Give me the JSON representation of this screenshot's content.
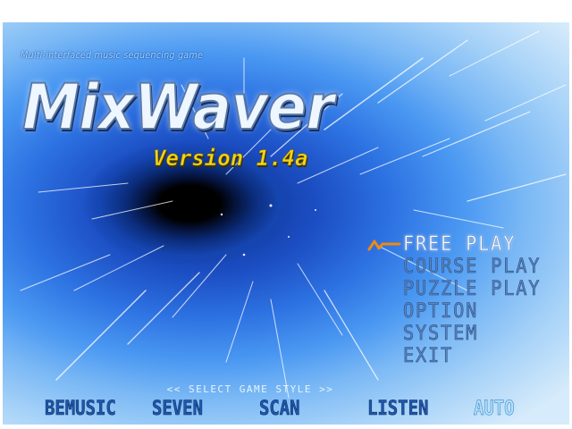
{
  "subtitle": "Multi-interfaced music sequencing game",
  "title": "MixWaver",
  "version": "Version 1.4a",
  "menu": {
    "items": [
      {
        "label": "FREE PLAY",
        "selected": true
      },
      {
        "label": "COURSE PLAY",
        "selected": false
      },
      {
        "label": "PUZZLE PLAY",
        "selected": false
      },
      {
        "label": "OPTION",
        "selected": false
      },
      {
        "label": "SYSTEM",
        "selected": false
      },
      {
        "label": "EXIT",
        "selected": false
      }
    ],
    "cursor_icon": "wave-cursor-icon"
  },
  "hint": "<< SELECT GAME STYLE >>",
  "game_styles": [
    {
      "label": "BEMUSIC",
      "selected": false
    },
    {
      "label": "SEVEN",
      "selected": false
    },
    {
      "label": "SCAN",
      "selected": false
    },
    {
      "label": "LISTEN",
      "selected": false
    },
    {
      "label": "AUTO",
      "selected": true
    }
  ],
  "colors": {
    "accent_yellow": "#f2d21e",
    "cursor_orange": "#f08a12",
    "menu_inactive": "#5f86b9",
    "menu_active": "#ffffff",
    "background_blue": "#2d72e2"
  }
}
